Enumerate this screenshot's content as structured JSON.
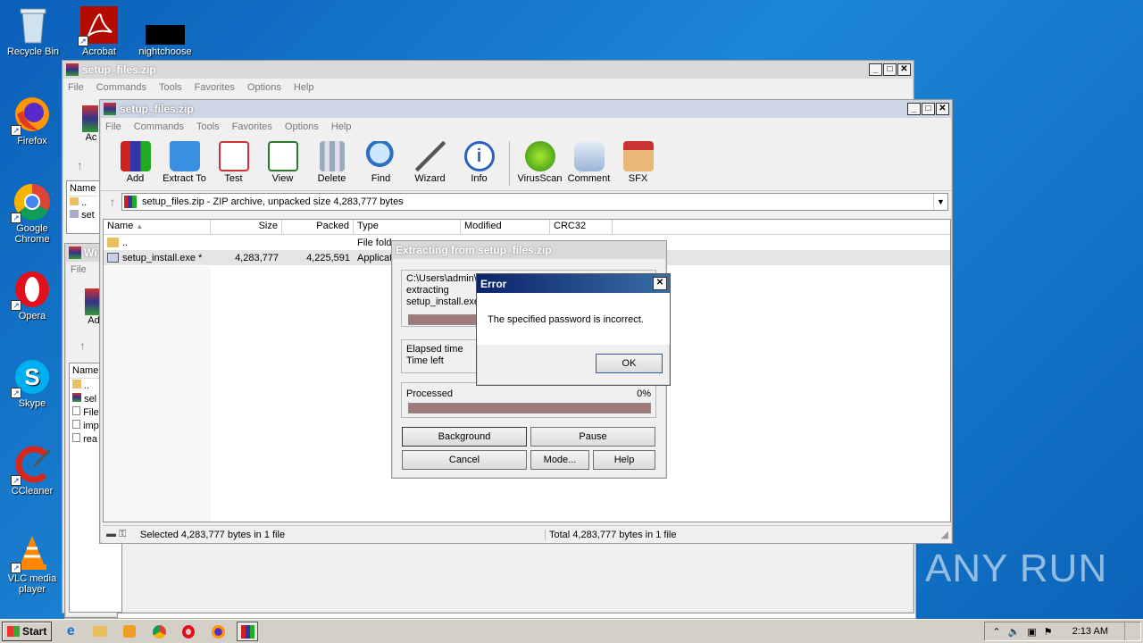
{
  "desktop": {
    "icons": [
      {
        "label": "Recycle Bin"
      },
      {
        "label": "Acrobat"
      },
      {
        "label": "nightchoose"
      },
      {
        "label": "Firefox"
      },
      {
        "label": "Google Chrome"
      },
      {
        "label": "Opera"
      },
      {
        "label": "Skype"
      },
      {
        "label": "CCleaner"
      },
      {
        "label": "VLC media player"
      }
    ],
    "watermark": "ANY RUN"
  },
  "back_window": {
    "title": "setup_files.zip",
    "menu": [
      "File",
      "Commands",
      "Tools",
      "Favorites",
      "Options",
      "Help"
    ],
    "partial": {
      "add": "Ac",
      "name_col": "Name",
      "row1": "..",
      "row2": "set"
    }
  },
  "back_window2": {
    "title": "Wi",
    "menu_file": "File",
    "add": "Ad",
    "name_col": "Name",
    "rows": [
      "..",
      "sel",
      "File",
      "imp",
      "rea"
    ]
  },
  "main_window": {
    "title": "setup_files.zip",
    "menu": [
      "File",
      "Commands",
      "Tools",
      "Favorites",
      "Options",
      "Help"
    ],
    "tools": [
      {
        "label": "Add",
        "icon": "add-icon"
      },
      {
        "label": "Extract To",
        "icon": "extract-icon"
      },
      {
        "label": "Test",
        "icon": "test-icon"
      },
      {
        "label": "View",
        "icon": "view-icon"
      },
      {
        "label": "Delete",
        "icon": "delete-icon"
      },
      {
        "label": "Find",
        "icon": "find-icon"
      },
      {
        "label": "Wizard",
        "icon": "wizard-icon"
      },
      {
        "label": "Info",
        "icon": "info-icon"
      },
      {
        "label": "VirusScan",
        "icon": "virusscan-icon"
      },
      {
        "label": "Comment",
        "icon": "comment-icon"
      },
      {
        "label": "SFX",
        "icon": "sfx-icon"
      }
    ],
    "address": "setup_files.zip - ZIP archive, unpacked size 4,283,777 bytes",
    "columns": [
      "Name",
      "Size",
      "Packed",
      "Type",
      "Modified",
      "CRC32"
    ],
    "rows": [
      {
        "name": "..",
        "size": "",
        "packed": "",
        "type": "File fold"
      },
      {
        "name": "setup_install.exe *",
        "size": "4,283,777",
        "packed": "4,225,591",
        "type": "Applicat"
      }
    ],
    "status_left": "Selected 4,283,777 bytes in 1 file",
    "status_right": "Total 4,283,777 bytes in 1 file"
  },
  "extract_dialog": {
    "title": "Extracting from setup_files.zip",
    "path_line": "C:\\Users\\admin\\",
    "action": "extracting",
    "file": "setup_install.exe",
    "elapsed_label": "Elapsed time",
    "timeleft_label": "Time left",
    "processed_label": "Processed",
    "processed_value": "0%",
    "buttons": {
      "background": "Background",
      "pause": "Pause",
      "cancel": "Cancel",
      "mode": "Mode...",
      "help": "Help"
    }
  },
  "error_dialog": {
    "title": "Error",
    "message": "The specified password is incorrect.",
    "ok": "OK"
  },
  "taskbar": {
    "start": "Start",
    "clock": "2:13 AM"
  },
  "colors": {
    "desktop": "#1d86d6",
    "error_title": "#0a246a"
  }
}
